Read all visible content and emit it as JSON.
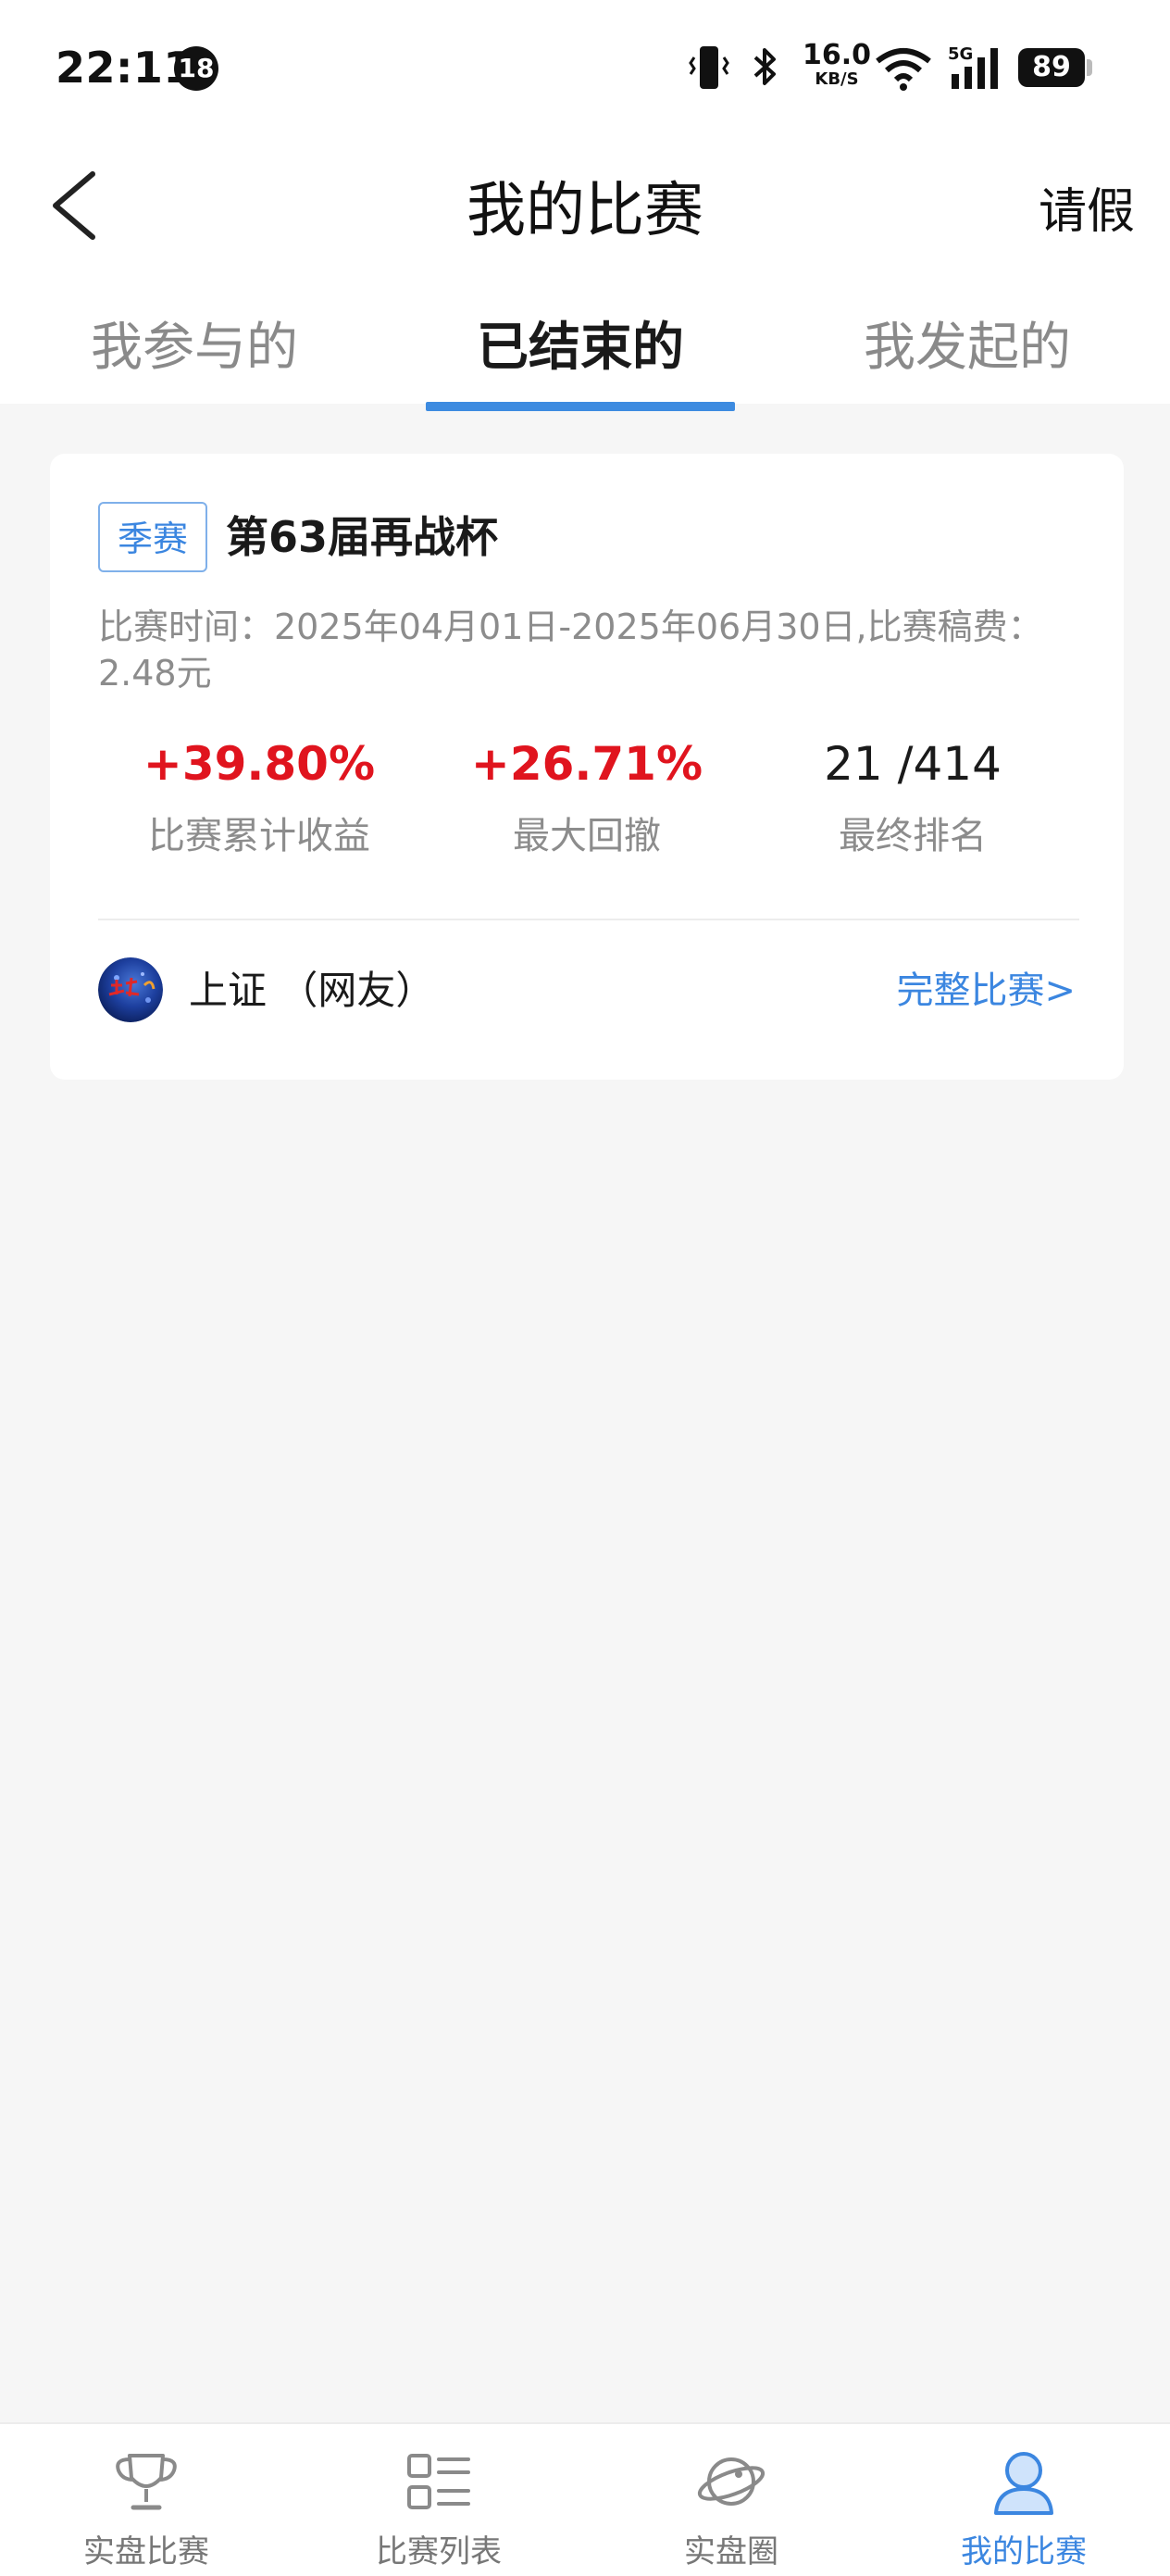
{
  "status_bar": {
    "time": "22:11",
    "notification_count": "18",
    "net_speed_value": "16.0",
    "net_speed_unit": "KB/S",
    "signal_label": "5G",
    "battery": "89"
  },
  "header": {
    "title": "我的比赛",
    "right_action": "请假",
    "back_icon": "chevron-left-icon"
  },
  "tabs": [
    {
      "label": "我参与的",
      "active": false
    },
    {
      "label": "已结束的",
      "active": true
    },
    {
      "label": "我发起的",
      "active": false
    }
  ],
  "card": {
    "tag": "季赛",
    "title": "第63届再战杯",
    "description": "比赛时间：2025年04月01日-2025年06月30日,比赛稿费：2.48元",
    "stats": [
      {
        "value": "+39.80%",
        "label": "比赛累计收益",
        "color": "#e0141e"
      },
      {
        "value": "+26.71%",
        "label": "最大回撤",
        "color": "#e0141e"
      },
      {
        "value": "21 /414",
        "label": "最终排名",
        "color": "#1a1a1a"
      }
    ],
    "user_name": "上证 （网友）",
    "full_link": "完整比赛>"
  },
  "bottom_nav": [
    {
      "label": "实盘比赛",
      "icon": "trophy-icon",
      "active": false
    },
    {
      "label": "比赛列表",
      "icon": "list-icon",
      "active": false
    },
    {
      "label": "实盘圈",
      "icon": "planet-icon",
      "active": false
    },
    {
      "label": "我的比赛",
      "icon": "user-icon",
      "active": true
    }
  ],
  "colors": {
    "accent": "#3d8be0",
    "positive": "#e0141e",
    "background": "#f6f6f6"
  }
}
